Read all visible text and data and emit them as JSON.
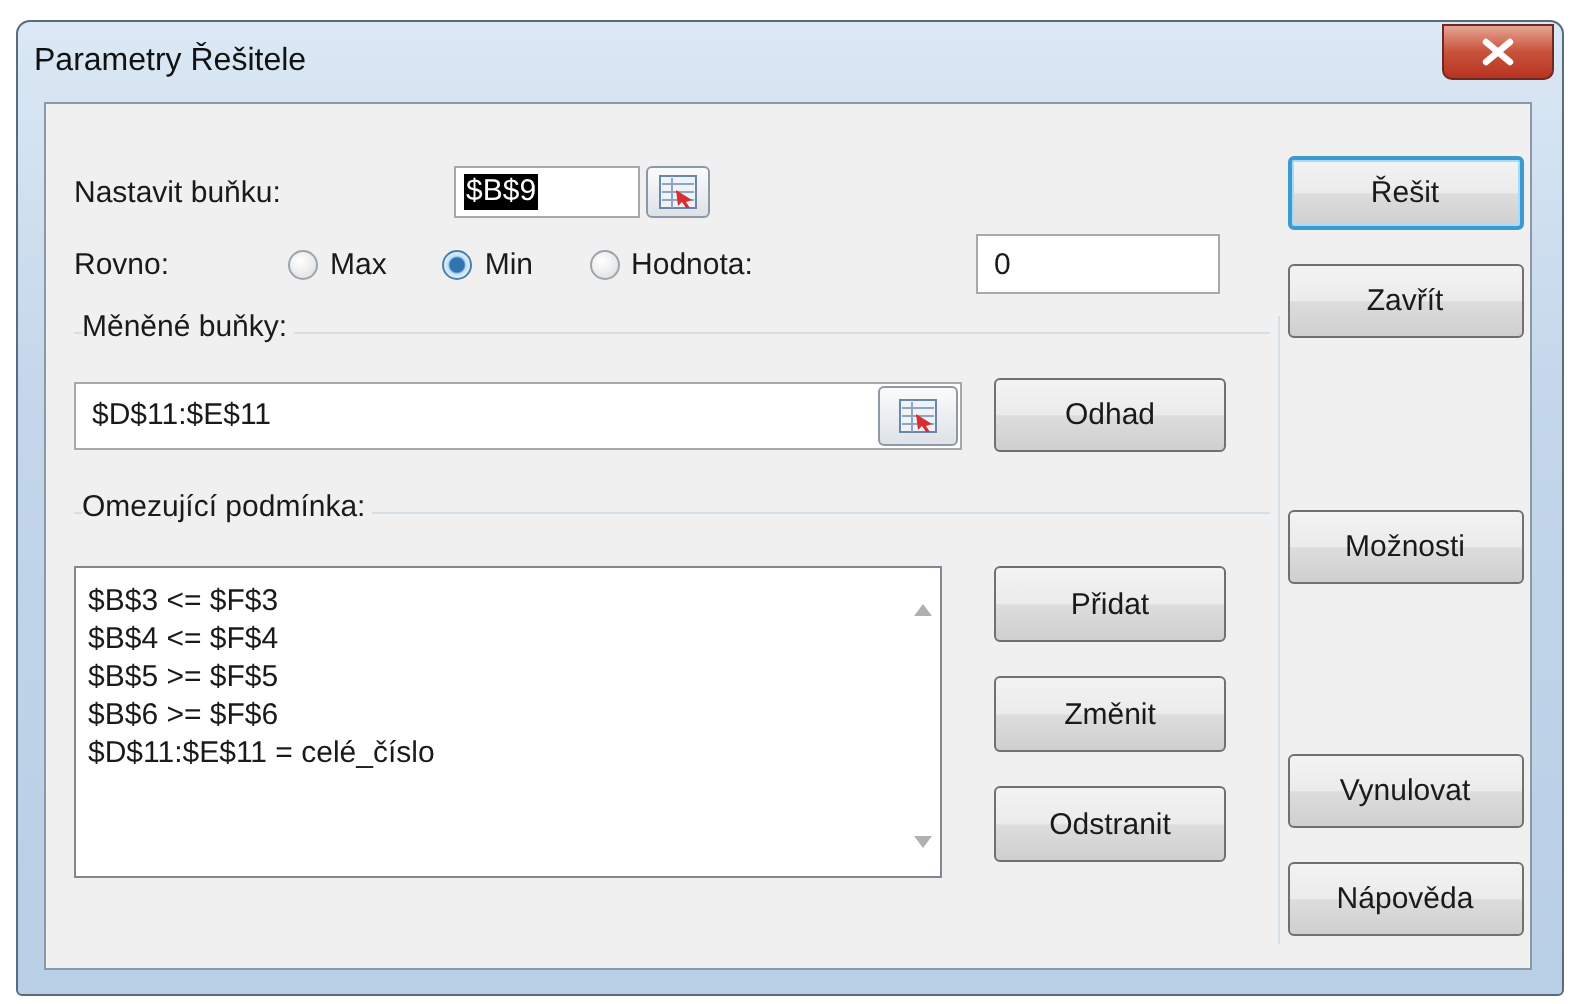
{
  "window": {
    "title": "Parametry Řešitele"
  },
  "target_cell": {
    "label": "Nastavit buňku:",
    "value": "$B$9"
  },
  "equal_to": {
    "label": "Rovno:",
    "options": [
      {
        "label": "Max",
        "selected": false
      },
      {
        "label": "Min",
        "selected": true
      },
      {
        "label": "Hodnota:",
        "selected": false
      }
    ],
    "value": "0"
  },
  "changing_cells": {
    "label": "Měněné buňky:",
    "value": "$D$11:$E$11",
    "button": "Odhad"
  },
  "constraints": {
    "label": "Omezující podmínka:",
    "items": [
      "$B$3 <= $F$3",
      "$B$4 <= $F$4",
      "$B$5 >= $F$5",
      "$B$6 >= $F$6",
      "$D$11:$E$11 = celé_číslo"
    ],
    "buttons": [
      "Přidat",
      "Změnit",
      "Odstranit"
    ]
  },
  "side_buttons": {
    "top": [
      {
        "label": "Řešit",
        "default": true
      },
      {
        "label": "Zavřít",
        "default": false
      }
    ],
    "middle": [
      {
        "label": "Možnosti",
        "default": false
      }
    ],
    "bottom": [
      {
        "label": "Vynulovat",
        "default": false
      },
      {
        "label": "Nápověda",
        "default": false
      }
    ]
  }
}
